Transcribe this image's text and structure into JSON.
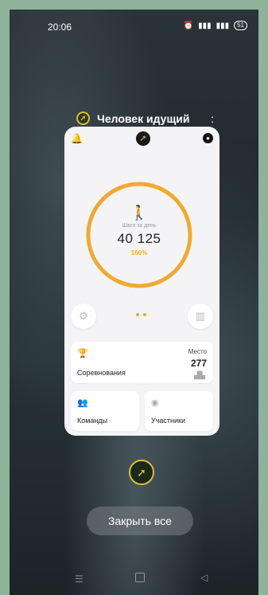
{
  "status": {
    "time": "20:06",
    "battery": "51"
  },
  "app": {
    "name": "Человек идущий"
  },
  "steps": {
    "caption": "Шаги за день",
    "value": "40 125",
    "percent": "160%",
    "progress_fraction": 1.0
  },
  "tiles": {
    "competitions": {
      "label": "Соревнования",
      "place_caption": "Место",
      "place_value": "277"
    },
    "teams": {
      "label": "Команды"
    },
    "participants": {
      "label": "Участники"
    }
  },
  "close_all_label": "Закрыть все",
  "colors": {
    "accent": "#f0aa30",
    "card_bg": "#f4f4f6"
  },
  "icons": {
    "bell": "bell-icon",
    "profile": "profile-icon",
    "settings": "gear-icon",
    "stats": "bar-chart-icon",
    "trophy": "trophy-icon",
    "teams": "teams-icon",
    "participant": "participant-icon",
    "podium": "podium-icon"
  }
}
